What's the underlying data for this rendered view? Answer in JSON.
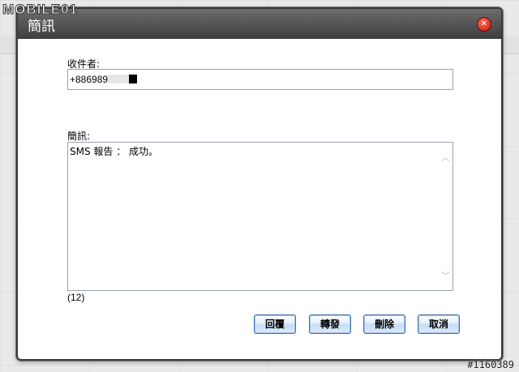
{
  "watermark": {
    "logo_text": "MOBILE01",
    "stamp": "#1160389"
  },
  "dialog": {
    "title": "簡訊",
    "close_icon": "close-icon",
    "recipient": {
      "label": "收件者:",
      "value": "+886989"
    },
    "message": {
      "label": "簡訊:",
      "text": "SMS 報告 ： 成功。",
      "char_count": "(12)"
    },
    "buttons": {
      "reply": "回覆",
      "forward": "轉發",
      "delete": "刪除",
      "cancel": "取消"
    }
  },
  "colors": {
    "titlebar": "#3e3e3e",
    "close": "#c4180a",
    "button_border": "#3e6ea5"
  }
}
